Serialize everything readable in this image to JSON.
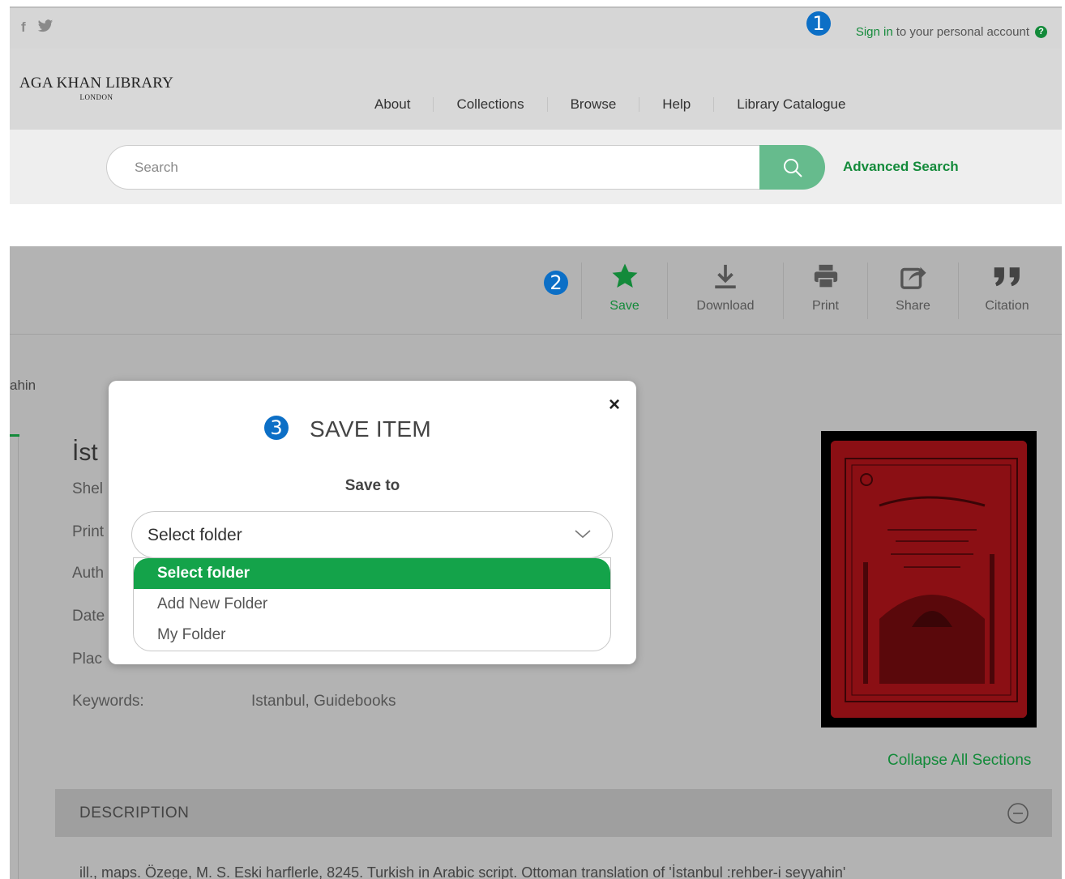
{
  "topbar": {
    "social": {
      "facebook": "f",
      "twitter": "🐦"
    },
    "badge_1": "1",
    "signin_link": "Sign in",
    "signin_rest": "to your personal account",
    "help_glyph": "?"
  },
  "header": {
    "logo_big": "AGA KHAN LIBRARY",
    "logo_small": "LONDON",
    "nav": [
      {
        "label": "About"
      },
      {
        "label": "Collections"
      },
      {
        "label": "Browse"
      },
      {
        "label": "Help"
      },
      {
        "label": "Library Catalogue"
      }
    ]
  },
  "search": {
    "placeholder": "Search",
    "advanced": "Advanced Search"
  },
  "toolbar": {
    "badge_2": "2",
    "save": "Save",
    "download": "Download",
    "print": "Print",
    "share": "Share",
    "citation": "Citation"
  },
  "record": {
    "breadcrumb_frag": "ahin",
    "title_frag": "İst",
    "shelf_frag": "Shel",
    "print_frag": "Print",
    "author_frag": "Auth",
    "date_frag": "Date",
    "place_frag": "Plac",
    "keywords_label": "Keywords:",
    "keywords_value": "Istanbul, Guidebooks",
    "collapse": "Collapse All Sections",
    "description_heading": "DESCRIPTION",
    "description_text": "ill., maps. Özege, M. S. Eski harflerle, 8245. Turkish in Arabic script. Ottoman translation of 'İstanbul :rehber-i seyyahin'"
  },
  "modal": {
    "badge_3": "3",
    "title": "SAVE ITEM",
    "close": "×",
    "subtitle": "Save to",
    "select_value": "Select folder",
    "options": [
      {
        "label": "Select folder",
        "selected": true
      },
      {
        "label": "Add New Folder",
        "selected": false
      },
      {
        "label": "My Folder",
        "selected": false
      }
    ]
  },
  "colors": {
    "brand_green": "#138a3a",
    "option_green": "#14a34a",
    "search_button": "#66bb8d",
    "badge_blue": "#0c6fc6"
  }
}
